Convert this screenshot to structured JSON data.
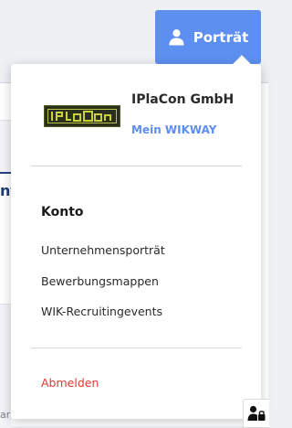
{
  "header": {
    "account_button_label": "Porträt",
    "account_button_icon": "user-icon",
    "accent_color": "#5d8ff0"
  },
  "dropdown": {
    "company_name": "IPlaCon GmbH",
    "company_logo_text": "IPlaCon",
    "mein_link": "Mein WIKWAY",
    "section_heading": "Konto",
    "menu_items": [
      {
        "label": "Unternehmensporträt"
      },
      {
        "label": "Bewerbungsmappen"
      },
      {
        "label": "WIK-Recruitingevents"
      }
    ],
    "logout_label": "Abmelden",
    "logout_color": "#e03a2f"
  },
  "background": {
    "fragment_bold": "nt",
    "fragment_small": "ar"
  },
  "floating": {
    "privacy_icon": "user-lock-icon"
  }
}
